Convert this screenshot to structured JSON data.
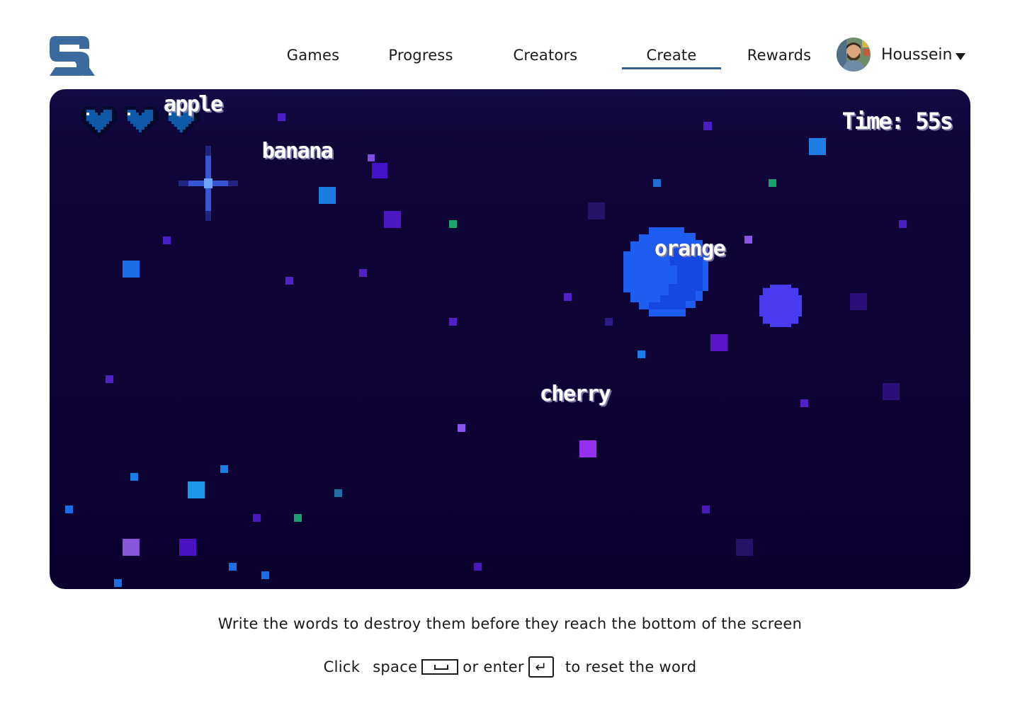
{
  "nav": {
    "games": "Games",
    "progress": "Progress",
    "creators": "Creators",
    "create": "Create",
    "rewards": "Rewards",
    "active": "Create"
  },
  "user": {
    "name": "Houssein"
  },
  "game": {
    "timer": "Time: 55s",
    "lives": 3,
    "words": [
      "apple",
      "banana",
      "orange",
      "cherry"
    ]
  },
  "instructions": {
    "line1": "Write the words to destroy them before they reach the bottom of the screen",
    "click": "Click",
    "space": "space",
    "or_enter": "or enter",
    "reset": "to reset the word"
  },
  "colors": {
    "brand": "#3b6a9e",
    "nav_underline": "#2f5e91",
    "game_bg": "#0c0230",
    "planet": "#1f5cf0",
    "heart": "#0f5aa8"
  }
}
